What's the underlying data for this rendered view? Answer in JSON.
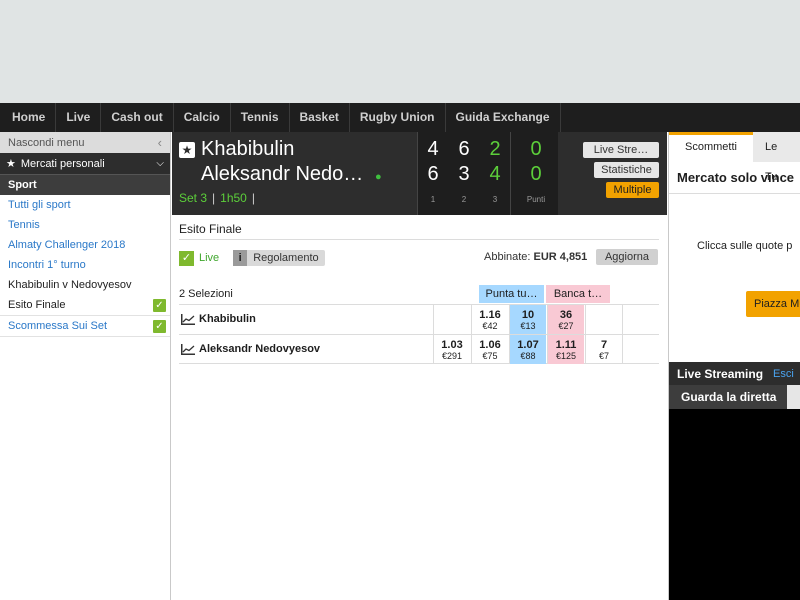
{
  "nav": [
    "Home",
    "Live",
    "Cash out",
    "Calcio",
    "Tennis",
    "Basket",
    "Rugby Union",
    "Guida Exchange"
  ],
  "sidebar": {
    "hide_menu": "Nascondi menu",
    "personal_markets": "Mercati personali",
    "sport": "Sport",
    "links": [
      "Tutti gli sport",
      "Tennis",
      "Almaty Challenger 2018",
      "Incontri 1° turno"
    ],
    "event": "Khabibulin v Nedovyesov",
    "markets": [
      {
        "label": "Esito Finale",
        "checked": true
      },
      {
        "label": "Scommessa Sui Set",
        "checked": true
      }
    ]
  },
  "event": {
    "player1": "Khabibulin",
    "player2": "Aleksandr Nedo…",
    "set": "Set 3",
    "time": "1h50",
    "sep": "|",
    "scores": {
      "p1": [
        "4",
        "6",
        "2",
        "0"
      ],
      "p2": [
        "6",
        "3",
        "4",
        "0"
      ],
      "labels": [
        "1",
        "2",
        "3",
        "Punti"
      ]
    },
    "buttons": {
      "stream": "Live Stre…",
      "stats": "Statistiche",
      "multiple": "Multiple"
    }
  },
  "market": {
    "title": "Esito Finale",
    "live": "Live",
    "rules_icon": "i",
    "rules": "Regolamento",
    "matched_label": "Abbinate:",
    "matched_value": "EUR 4,851",
    "refresh": "Aggiorna",
    "selections": "2 Selezioni",
    "back_header": "Punta tu…",
    "lay_header": "Banca t…",
    "runners": [
      {
        "name": "Khabibulin",
        "cells": [
          {
            "p": "",
            "s": ""
          },
          {
            "p": "1.16",
            "s": "€42"
          },
          {
            "p": "10",
            "s": "€13"
          },
          {
            "p": "36",
            "s": "€27"
          },
          {
            "p": "",
            "s": ""
          },
          {
            "p": "",
            "s": ""
          }
        ]
      },
      {
        "name": "Aleksandr Nedovyesov",
        "cells": [
          {
            "p": "1.03",
            "s": "€291"
          },
          {
            "p": "1.06",
            "s": "€75"
          },
          {
            "p": "1.07",
            "s": "€88"
          },
          {
            "p": "1.11",
            "s": "€125"
          },
          {
            "p": "7",
            "s": "€7"
          },
          {
            "p": "",
            "s": ""
          }
        ]
      }
    ]
  },
  "right": {
    "tabs": [
      "Scommetti",
      "Le Tu"
    ],
    "title": "Mercato solo vince",
    "hint": "Clicca sulle quote p",
    "place": "Piazza Mu",
    "streaming": "Live Streaming",
    "exit": "Esci",
    "watch": "Guarda la diretta"
  },
  "colors": {
    "accent": "#f2a200",
    "back": "#a6d8ff",
    "lay": "#f9c9d4",
    "live_green": "#5ccf3a",
    "link": "#2a78c8"
  }
}
